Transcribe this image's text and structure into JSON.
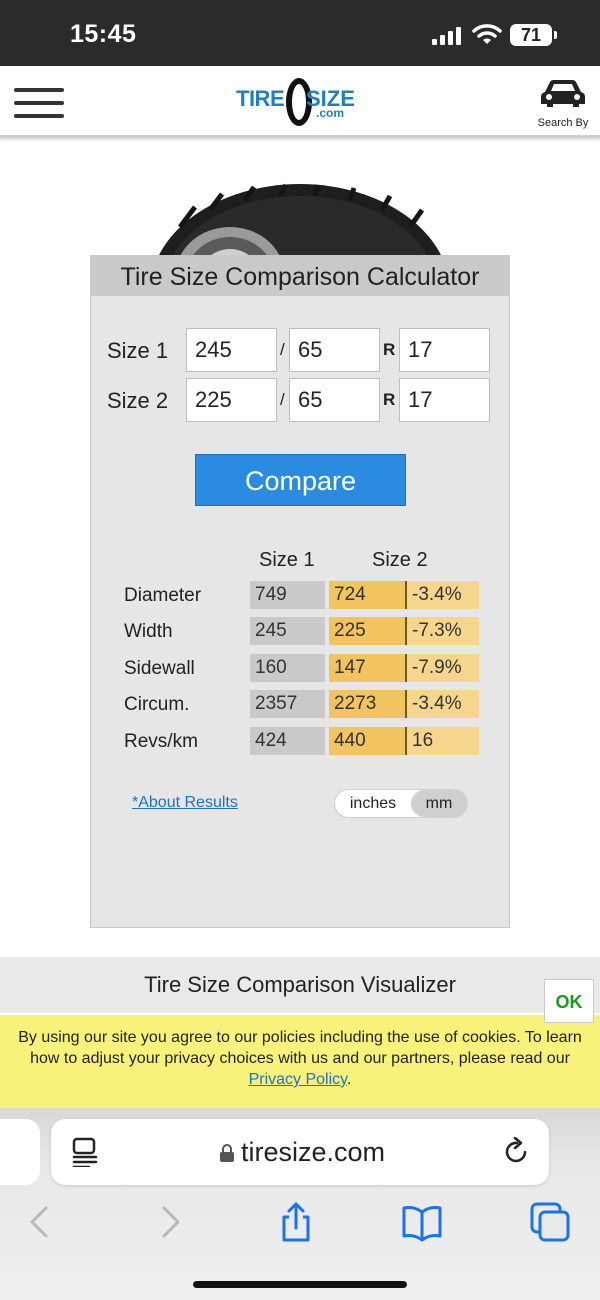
{
  "status_bar": {
    "time": "15:45",
    "battery": "71"
  },
  "header": {
    "logo_text_1": "TIRE",
    "logo_text_2": "SIZE",
    "logo_text_3": ".com",
    "search_by_label": "Search By"
  },
  "calculator": {
    "title": "Tire Size Comparison Calculator",
    "size1": {
      "label": "Size 1",
      "width": "245",
      "aspect": "65",
      "rim": "17"
    },
    "size2": {
      "label": "Size 2",
      "width": "225",
      "aspect": "65",
      "rim": "17"
    },
    "separator_slash": "/",
    "separator_r": "R",
    "compare_label": "Compare",
    "col_size1": "Size 1",
    "col_size2": "Size 2",
    "rows": [
      {
        "label": "Diameter",
        "size1": "749",
        "size2": "724",
        "diff": "-3.4%"
      },
      {
        "label": "Width",
        "size1": "245",
        "size2": "225",
        "diff": "-7.3%"
      },
      {
        "label": "Sidewall",
        "size1": "160",
        "size2": "147",
        "diff": "-7.9%"
      },
      {
        "label": "Circum.",
        "size1": "2357",
        "size2": "2273",
        "diff": "-3.4%"
      },
      {
        "label": "Revs/km",
        "size1": "424",
        "size2": "440",
        "diff": "16"
      }
    ],
    "about_results": "*About Results",
    "unit_inches": "inches",
    "unit_mm": "mm",
    "unit_selected": "mm"
  },
  "visualizer": {
    "title": "Tire Size Comparison Visualizer"
  },
  "cookie": {
    "text_before": "By using our site you agree to our policies including the use of cookies. To learn how to adjust your privacy choices with us and our partners, please read our ",
    "link": "Privacy Policy",
    "text_after": ".",
    "ok_label": "OK"
  },
  "browser": {
    "url": "tiresize.com"
  },
  "colors": {
    "accent_blue": "#2a8be0",
    "size2_cell": "#f2c460",
    "diff_cell": "#f6d68c",
    "cookie_bg": "#f8f27a",
    "ok_green": "#1a9b1a"
  }
}
